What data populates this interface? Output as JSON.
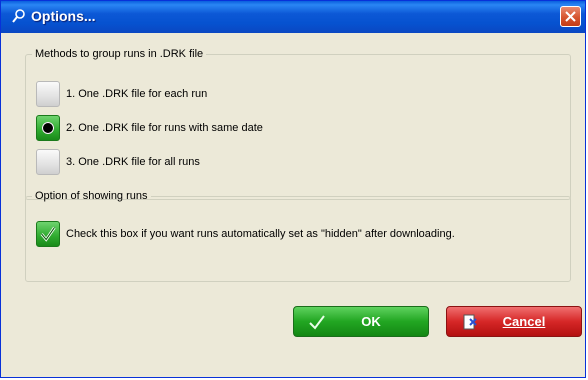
{
  "window": {
    "title": "Options...",
    "title_icon": "search-icon",
    "close_icon": "close-icon"
  },
  "group_runs": {
    "legend": "Methods to group runs in .DRK file",
    "options": [
      {
        "label": "1.  One .DRK file for each run",
        "selected": false
      },
      {
        "label": "2.  One .DRK file for runs with same date",
        "selected": true
      },
      {
        "label": "3.  One .DRK file for all runs",
        "selected": false
      }
    ]
  },
  "show_runs": {
    "legend": "Option of showing runs",
    "checkbox_label": "Check this box if you want runs automatically set as \"hidden\" after downloading.",
    "checked": true
  },
  "buttons": {
    "ok_label": "OK",
    "cancel_label": "Cancel",
    "ok_icon": "check-icon",
    "cancel_icon": "cancel-icon"
  },
  "colors": {
    "title_bar": "#0a5fde",
    "ok_green": "#22a622",
    "cancel_red": "#d62727",
    "panel": "#ece9d8"
  }
}
